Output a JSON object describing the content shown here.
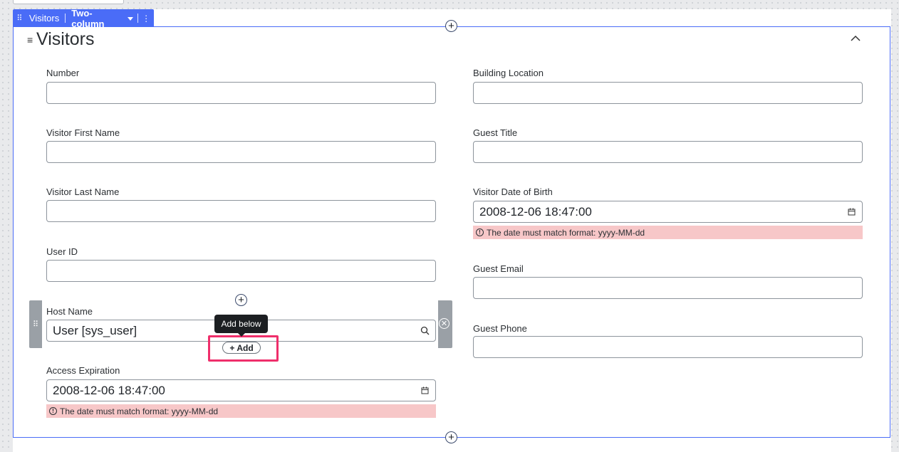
{
  "toolbar": {
    "title": "Visitors",
    "layout": "Two-column",
    "more_glyph": "⋮"
  },
  "section": {
    "title": "Visitors",
    "menu_glyph": "≡"
  },
  "left_fields": [
    {
      "label": "Number",
      "value": ""
    },
    {
      "label": "Visitor First Name",
      "value": ""
    },
    {
      "label": "Visitor Last Name",
      "value": ""
    },
    {
      "label": "User ID",
      "value": ""
    }
  ],
  "host_field": {
    "label": "Host Name",
    "value": "User [sys_user]",
    "icon": "search-icon"
  },
  "access_field": {
    "label": "Access Expiration",
    "value": "2008-12-06 18:47:00",
    "icon": "calendar-icon",
    "error": "The date must match format: yyyy-MM-dd"
  },
  "right_fields": [
    {
      "label": "Building Location",
      "value": ""
    },
    {
      "label": "Guest Title",
      "value": ""
    },
    {
      "label": "Visitor Date of Birth",
      "value": "2008-12-06 18:47:00",
      "icon": "calendar-icon",
      "error": "The date must match format: yyyy-MM-dd"
    },
    {
      "label": "Guest Email",
      "value": ""
    },
    {
      "label": "Guest Phone",
      "value": ""
    }
  ],
  "tooltip": "Add below",
  "add_button": {
    "glyph": "+",
    "label": "Add"
  },
  "colors": {
    "accent": "#4a6cf7",
    "error_bg": "#f7c7c8",
    "highlight": "#ef2f6b"
  }
}
